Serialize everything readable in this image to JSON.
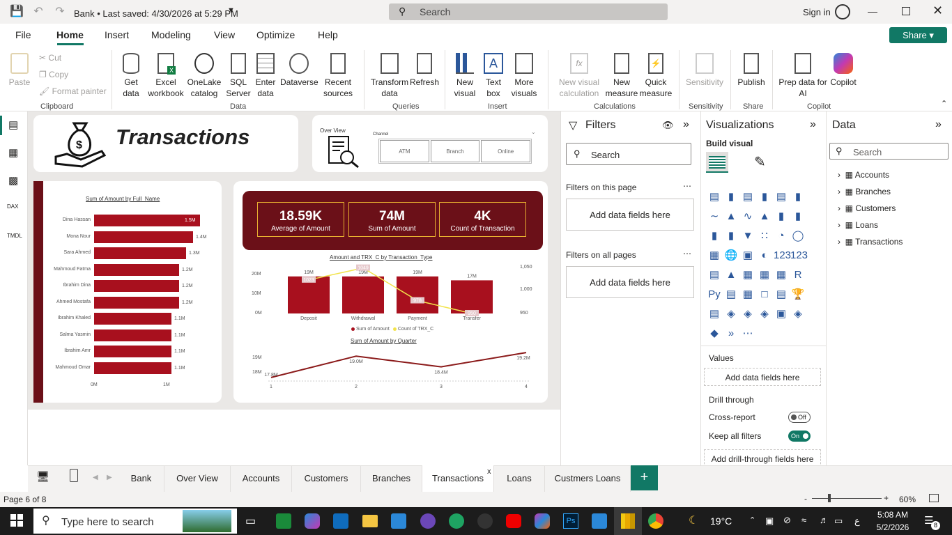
{
  "titlebar": {
    "title": "Bank • Last saved: 4/30/2026 at 5:29 PM",
    "search": "Search",
    "signin": "Sign in"
  },
  "menu": {
    "file": "File",
    "home": "Home",
    "insert": "Insert",
    "modeling": "Modeling",
    "view": "View",
    "optimize": "Optimize",
    "help": "Help",
    "share": "Share"
  },
  "ribbon": {
    "paste": "Paste",
    "cut": "Cut",
    "copy": "Copy",
    "format_painter": "Format painter",
    "get_data": "Get data",
    "excel": "Excel workbook",
    "onelake": "OneLake catalog",
    "sql": "SQL Server",
    "enter": "Enter data",
    "dataverse": "Dataverse",
    "recent": "Recent sources",
    "transform": "Transform data",
    "refresh": "Refresh",
    "new_visual": "New visual",
    "text_box": "Text box",
    "more_visuals": "More visuals",
    "new_visual_calc": "New visual calculation",
    "new_measure": "New measure",
    "quick_measure": "Quick measure",
    "sensitivity": "Sensitivity",
    "publish": "Publish",
    "prep_copilot": "Prep data for AI",
    "copilot": "Copilot",
    "groups": {
      "clipboard": "Clipboard",
      "data": "Data",
      "queries": "Queries",
      "insert": "Insert",
      "calculations": "Calculations",
      "sensitivity": "Sensitivity",
      "share": "Share",
      "copilot": "Copilot"
    }
  },
  "report": {
    "title": "Transactions",
    "overview": "Over View",
    "slicer": {
      "label": "Channel",
      "options": [
        "ATM",
        "Branch",
        "Online"
      ]
    },
    "bar_title": "Sum of Amount by Full_Name",
    "bars": [
      {
        "name": "Dina Hassan",
        "value": "1.5M"
      },
      {
        "name": "Mona Nour",
        "value": "1.4M"
      },
      {
        "name": "Sara Ahmed",
        "value": "1.3M"
      },
      {
        "name": "Mahmoud Fatma",
        "value": "1.2M"
      },
      {
        "name": "Ibrahim Dina",
        "value": "1.2M"
      },
      {
        "name": "Ahmed Mostafa",
        "value": "1.2M"
      },
      {
        "name": "Ibrahim Khaled",
        "value": "1.1M"
      },
      {
        "name": "Salma Yasmin",
        "value": "1.1M"
      },
      {
        "name": "Ibrahim Amr",
        "value": "1.1M"
      },
      {
        "name": "Mahmoud Omar",
        "value": "1.1M"
      }
    ],
    "bar_axis": [
      "0M",
      "1M"
    ],
    "kpis": [
      {
        "value": "18.59K",
        "label": "Average of Amount"
      },
      {
        "value": "74M",
        "label": "Sum of Amount"
      },
      {
        "value": "4K",
        "label": "Count of Transaction"
      }
    ],
    "combo_title": "Amount and TRX_C by Transaction_Type",
    "combo_legend": [
      "Sum of Amount",
      "Count of TRX_C"
    ],
    "combo_y_left": [
      "20M",
      "10M",
      "0M"
    ],
    "combo_y_right": [
      "1,050",
      "1,000",
      "950"
    ],
    "line_title": "Sum of Amount by Quarter",
    "line_y": [
      "19M",
      "18M"
    ]
  },
  "chart_data": [
    {
      "type": "bar",
      "title": "Sum of Amount by Full_Name",
      "categories": [
        "Dina Hassan",
        "Mona Nour",
        "Sara Ahmed",
        "Mahmoud Fatma",
        "Ibrahim Dina",
        "Ahmed Mostafa",
        "Ibrahim Khaled",
        "Salma Yasmin",
        "Ibrahim Amr",
        "Mahmoud Omar"
      ],
      "values": [
        1.5,
        1.4,
        1.3,
        1.2,
        1.2,
        1.2,
        1.1,
        1.1,
        1.1,
        1.1
      ],
      "xlim": [
        0,
        1.5
      ]
    },
    {
      "type": "bar",
      "title": "Amount and TRX_C by Transaction_Type",
      "categories": [
        "Deposit",
        "Withdrawal",
        "Payment",
        "Transfer"
      ],
      "series": [
        {
          "name": "Sum of Amount",
          "values": [
            19,
            19,
            19,
            17
          ]
        },
        {
          "name": "Count of TRX_C",
          "values": [
            1023,
            1049,
            978,
            950
          ]
        }
      ],
      "ylim": [
        0,
        20
      ],
      "y2lim": [
        950,
        1050
      ]
    },
    {
      "type": "line",
      "title": "Sum of Amount by Quarter",
      "x": [
        1,
        2,
        3,
        4
      ],
      "values": [
        17.8,
        19.0,
        18.4,
        19.2
      ],
      "labels": [
        "17.8M",
        "19.0M",
        "18.4M",
        "19.2M"
      ]
    }
  ],
  "filters": {
    "title": "Filters",
    "search": "Search",
    "this_page": "Filters on this page",
    "all_pages": "Filters on all pages",
    "add": "Add data fields here"
  },
  "viz": {
    "title": "Visualizations",
    "build": "Build visual",
    "values": "Values",
    "add_values": "Add data fields here",
    "drill": "Drill through",
    "cross": "Cross-report",
    "cross_state": "Off",
    "keep": "Keep all filters",
    "keep_state": "On",
    "add_drill": "Add drill-through fields here"
  },
  "data_pane": {
    "title": "Data",
    "search": "Search",
    "tables": [
      "Accounts",
      "Branches",
      "Customers",
      "Loans",
      "Transactions"
    ]
  },
  "tabs": [
    "Bank",
    "Over View",
    "Accounts",
    "Customers",
    "Branches",
    "Transactions",
    "Loans",
    "Custmers Loans"
  ],
  "status": {
    "page": "Page 6 of 8",
    "zoom": "60%"
  },
  "taskbar": {
    "search": "Type here to search",
    "temp": "19°C",
    "time": "5:08 AM",
    "date": "5/2/2026",
    "lang": "ع",
    "notif": "8"
  },
  "colors": {
    "accent": "#117865",
    "bar": "#a8101e",
    "kpi_bg": "#6b1018",
    "line": "#8b1a1a",
    "trx_line": "#f2e34b"
  }
}
